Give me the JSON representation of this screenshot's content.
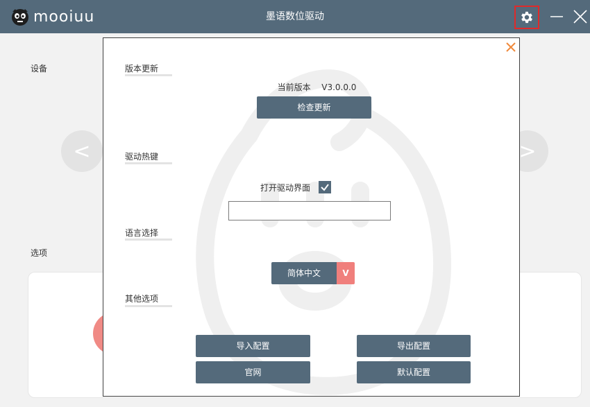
{
  "app": {
    "logo_text": "mooiuu",
    "title": "墨语数位驱动"
  },
  "background": {
    "devices_label": "设备",
    "options_label": "选项",
    "prev_arrow": "<",
    "next_arrow": ">"
  },
  "dialog": {
    "sections": {
      "version_update": "版本更新",
      "driver_hotkey": "驱动热键",
      "language": "语言选择",
      "other_options": "其他选项"
    },
    "version": {
      "label": "当前版本",
      "value": "V3.0.0.0",
      "check_update_button": "检查更新"
    },
    "hotkey": {
      "open_driver_label": "打开驱动界面",
      "open_driver_checked": true,
      "input_value": ""
    },
    "language": {
      "selected": "简体中文",
      "caret": "V"
    },
    "buttons": {
      "import_config": "导入配置",
      "export_config": "导出配置",
      "official_site": "官网",
      "default_config": "默认配置"
    }
  },
  "colors": {
    "titlebar": "#546a7b",
    "button": "#546a7b",
    "accent_red": "#f07f7c",
    "close_orange": "#f08a3c",
    "highlight_border": "#e02a2a"
  },
  "icons": {
    "settings": "gear-icon",
    "minimize": "minimize-icon",
    "close": "close-icon",
    "dialog_close": "close-icon",
    "checkbox": "checkmark-icon"
  }
}
